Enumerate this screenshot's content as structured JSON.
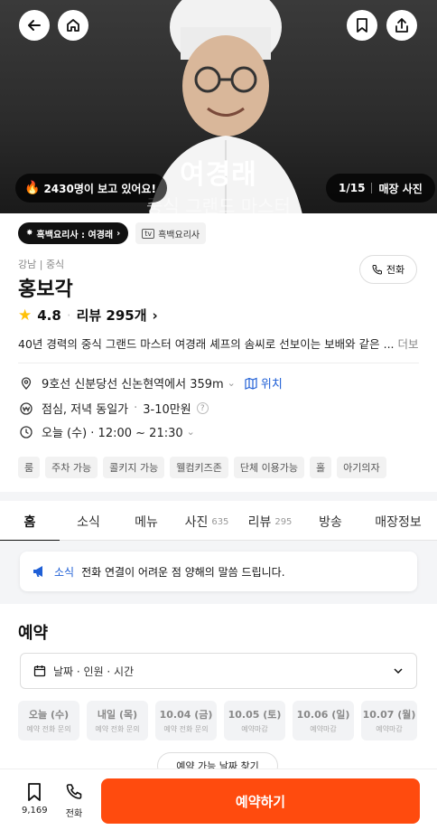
{
  "hero": {
    "name": "여경래",
    "subtitle": "중식 그랜드 마스터",
    "viewers": "2430명이 보고 있어요!",
    "photo_counter": "1/15",
    "store_photo_label": "매장 사진"
  },
  "badges": {
    "program": "흑백요리사 : 여경래",
    "tv": "흑백요리사"
  },
  "store": {
    "category": "강남 | 중식",
    "name": "홍보각",
    "call_label": "전화",
    "rating": "4.8",
    "review_label": "리뷰 295개",
    "description": "40년 경력의 중식 그랜드 마스터 여경래 셰프의 솜씨로 선보이는 보배와 같은 ...",
    "more_label": "더보기"
  },
  "info": {
    "location": "9호선 신분당선 신논현역에서 359m",
    "location_link": "위치",
    "price_meals": "점심, 저녁 동일가",
    "price_range": "3-10만원",
    "hours": "오늘 (수) · 12:00 ~ 21:30"
  },
  "tags": [
    "룸",
    "주차 가능",
    "콜키지 가능",
    "웰컴키즈존",
    "단체 이용가능",
    "홀",
    "아기의자"
  ],
  "tabs": [
    {
      "label": "홈",
      "count": ""
    },
    {
      "label": "소식",
      "count": ""
    },
    {
      "label": "메뉴",
      "count": ""
    },
    {
      "label": "사진",
      "count": "635"
    },
    {
      "label": "리뷰",
      "count": "295"
    },
    {
      "label": "방송",
      "count": ""
    },
    {
      "label": "매장정보",
      "count": ""
    }
  ],
  "notice": {
    "label": "소식",
    "text": "전화 연결이 어려운 점 양해의 말씀 드립니다."
  },
  "reservation": {
    "title": "예약",
    "select_placeholder": "날짜 · 인원 · 시간",
    "dates": [
      {
        "date": "오늘 (수)",
        "status": "예약 전화 문의"
      },
      {
        "date": "내일 (목)",
        "status": "예약 전화 문의"
      },
      {
        "date": "10.04 (금)",
        "status": "예약 전화 문의"
      },
      {
        "date": "10.05 (토)",
        "status": "예약마감"
      },
      {
        "date": "10.06 (일)",
        "status": "예약마감"
      },
      {
        "date": "10.07 (월)",
        "status": "예약마감"
      }
    ],
    "find_button": "예약 가능 날짜 찾기"
  },
  "bottom": {
    "bookmark_count": "9,169",
    "call_label": "전화",
    "reserve_label": "예약하기"
  },
  "colors": {
    "accent": "#ff4b0e",
    "link": "#1f5fd6",
    "star": "#ffc107"
  }
}
